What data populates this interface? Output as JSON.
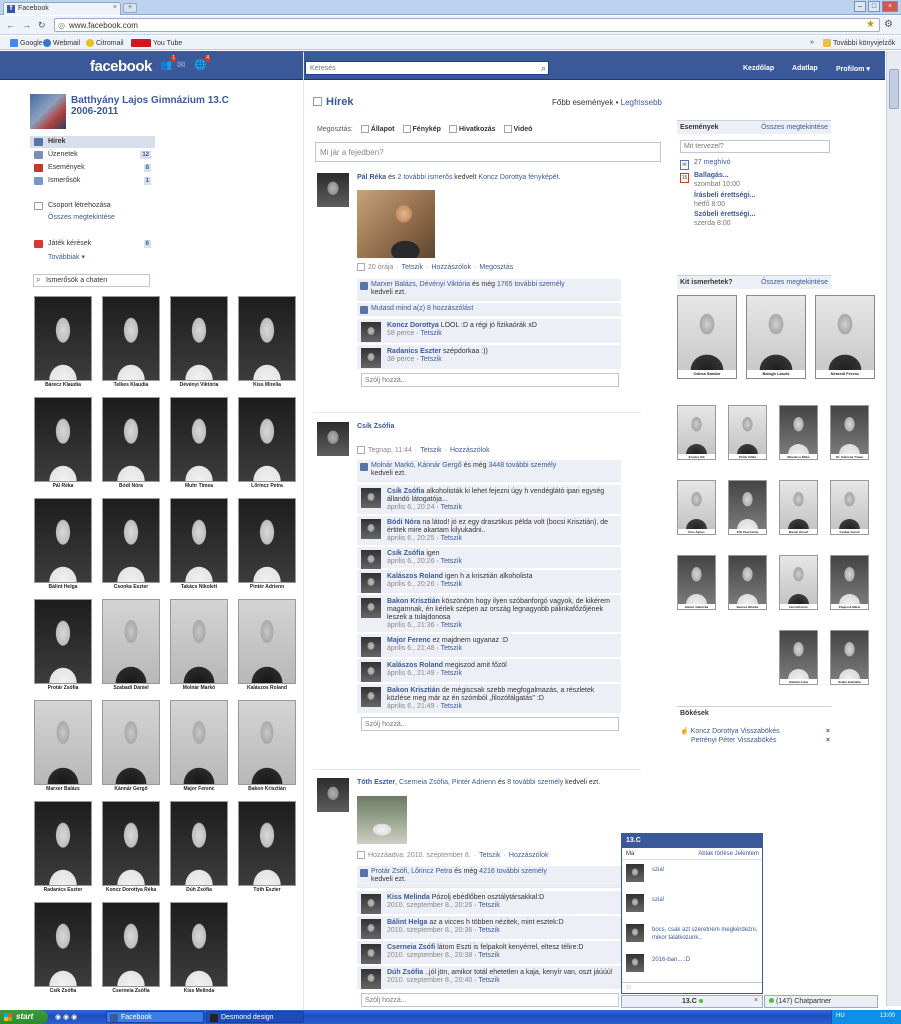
{
  "browser": {
    "tab_title": "Facebook",
    "url": "www.facebook.com",
    "bookmarks": [
      {
        "label": "Google",
        "color": "#4285f4"
      },
      {
        "label": "Webmail",
        "color": "#3a78c9"
      },
      {
        "label": "Citromail",
        "color": "#e5c21f"
      },
      {
        "label": "You Tube",
        "color": "#cc181e"
      }
    ],
    "other_bookmarks": "További könyvjelzők",
    "overflow": "»"
  },
  "header": {
    "logo": "facebook",
    "notif_counts": [
      "1",
      "4"
    ],
    "search_placeholder": "Keresés",
    "links": [
      "Kezdőlap",
      "Adatlap",
      "Profilom ▾"
    ]
  },
  "group": {
    "name": "Batthyány Lajos Gimnázium 13.C 2006-2011",
    "nav": [
      {
        "label": "Hírek",
        "count": "",
        "selected": true,
        "color": "#5b74a8"
      },
      {
        "label": "Üzenetek",
        "count": "12",
        "color": "#7a8fb8"
      },
      {
        "label": "Események",
        "count": "8",
        "color": "#c0392b"
      },
      {
        "label": "Ismerősök",
        "count": "1",
        "color": "#7b96c9"
      }
    ],
    "create_group": "Csoport létrehozása",
    "see_all": "Összes megtekintése",
    "game_requests": "Játék kérések",
    "game_count": "6",
    "more": "Továbbiak ▾",
    "chat_search": "Ismerősök a chaten",
    "classmates": [
      "Bárecz Klaudia",
      "Telkes Klaudia",
      "Dévényi Viktória",
      "Kiss Mirella",
      "Pál Réka",
      "Bódi Nóra",
      "Muhr Tímea",
      "Lőrincz Petra",
      "Bálint Helga",
      "Csonka Eszter",
      "Takács Nikolett",
      "Pintér Adrienn",
      "Protár Zsófia",
      "Szabadi Dániel",
      "Molnár Markó",
      "Kalászos Roland",
      "Marxer Balázs",
      "Kánnár Gergő",
      "Major Ferenc",
      "Bakon Krisztián",
      "Radanics Eszter",
      "Koncz Dorottya Réka",
      "Dúh Zsófia",
      "Tóth Eszter",
      "Csík Zsófia",
      "Cserneia Zsófia",
      "Kiss Melinda"
    ]
  },
  "feed": {
    "title": "Hírek",
    "top_stories": "Főbb események",
    "sep": " • ",
    "most_recent": "Legfrissebb",
    "share_label": "Megosztás:",
    "share_options": [
      "Állapot",
      "Fénykép",
      "Hivatkozás",
      "Videó"
    ],
    "status_placeholder": "Mi jár a fejedben?",
    "reply_placeholder": "Szólj hozzá...",
    "story1": {
      "author": "Pál Réka",
      "mid": " és ",
      "others": "2 további ismerős",
      "tail": " kedvelt ",
      "target": "Koncz Dorottya fényképét.",
      "meta_time": "20 órája",
      "meta_links": [
        "Tetszik",
        "Hozzászólok",
        "Megosztás"
      ],
      "likes_names": "Marxer Balázs, Dévényi Viktória",
      "likes_mid": " és még ",
      "likes_count": "1765 további személy",
      "likes_tail": "kedveli ezt.",
      "show_all": "Mutasd mind a(z) 8 hozzászólást",
      "comments": [
        {
          "name": "Koncz Dorottya",
          "text": "LOOL :D a régi jó fizikaórák xD",
          "time": "58 perce",
          "like": "Tetszik"
        },
        {
          "name": "Radanics Eszter",
          "text": "szépdorkaa :))",
          "time": "38 perce",
          "like": "Tetszik"
        }
      ]
    },
    "story2": {
      "author": "Csík Zsófia",
      "meta_time": "Tegnap, 11:44",
      "meta_links": [
        "Tetszik",
        "Hozzászólok"
      ],
      "likes_names": "Molnár Markó, Kánnár Gergő",
      "likes_mid": " és még ",
      "likes_count": "3448 további személy",
      "likes_tail": "kedveli ezt.",
      "comments": [
        {
          "name": "Csík Zsófia",
          "text": "alkoholisták ki lehet fejezni úgy h vendéglátó ipari egység állandó látogatója...",
          "time": "április 6., 20:24",
          "like": "Tetszik"
        },
        {
          "name": "Bódi Nóra",
          "text": "na látod! jó ez egy drasztikus példa volt (bocsi Krisztián), de értitek mire akartam kilyukadni..",
          "time": "április 6., 20:25",
          "like": "Tetszik"
        },
        {
          "name": "Csík Zsófia",
          "text": "igen",
          "time": "április 6., 20:26",
          "like": "Tetszik"
        },
        {
          "name": "Kalászos Roland",
          "text": "igen h a krisztián alkoholista",
          "time": "április 6., 20:26",
          "like": "Tetszik"
        },
        {
          "name": "Bakon Krisztián",
          "text": "köszönöm hogy ilyen szóbanforgó vagyok, de kikérem magamnak, én kérlek szépen az ország legnagyobb pálinkafőzőjének leszek a tulajdonosa",
          "time": "április 6., 21:36",
          "like": "Tetszik"
        },
        {
          "name": "Major Ferenc",
          "text": "ez majdnem ugyanaz :D",
          "time": "április 6., 21:48",
          "like": "Tetszik"
        },
        {
          "name": "Kalászos Roland",
          "text": "megiszod amit főzöl",
          "time": "április 6., 21:49",
          "like": "Tetszik"
        },
        {
          "name": "Bakon Krisztián",
          "text": "de mégiscsak szebb megfogalmazás, a részletek közlése meg már az én szómból „filozófálgatás\" :D",
          "time": "április 6., 21:49",
          "like": "Tetszik"
        }
      ]
    },
    "story3": {
      "author": "Tóth Eszter",
      "mid": ", ",
      "others": "Cserneia Zsófia, Pintér Adrienn",
      "and": " és ",
      "count": "8 további személy",
      "tail": " kedveli ezt.",
      "meta_time": "Hozzáadva: 2010. szeptember 8.",
      "meta_links": [
        "Tetszik",
        "Hozzászólok"
      ],
      "likes_names": "Protár Zsófi, Lőrincz Petra",
      "likes_mid": " és még ",
      "likes_count": "4216 további személy",
      "likes_tail": "kedveli ezt.",
      "comments": [
        {
          "name": "Kiss Melinda",
          "text": "Pózolj ebédlőben osztálytársakkal:D",
          "time": "2010. szeptember 8., 20:26",
          "like": "Tetszik"
        },
        {
          "name": "Bálint Helga",
          "text": "az a vicces h többen nézitek, mint esztek:D",
          "time": "2010. szeptember 8., 20:36",
          "like": "Tetszik"
        },
        {
          "name": "Cserneia Zsófi",
          "text": "látom Eszti is felpakolt kenyérrel, eltesz télire:D",
          "time": "2010. szeptember 8., 20:38",
          "like": "Tetszik"
        },
        {
          "name": "Dúh Zsófia",
          "text": "..jól jön, amikor totál ehetetlen a kaja, kenyír van, oszt jáúúú!",
          "time": "2010. szeptember 8., 20:40",
          "like": "Tetszik"
        }
      ]
    }
  },
  "right": {
    "events_title": "Események",
    "see_all": "Összes megtekintése",
    "event_placeholder": "Mit tervezel?",
    "invites": "27 meghívó",
    "events": [
      {
        "name": "Ballagás...",
        "time": "szombat 10:00"
      },
      {
        "name": "Írásbeli érettségi...",
        "time": "hétfő 8:00"
      },
      {
        "name": "Szóbeli érettségi...",
        "time": "szerda 8:00"
      }
    ],
    "know_title": "Kit ismerhetek?",
    "teachers_big": [
      "Odesa Sándor",
      "Balogh László",
      "Némedi Ferenc"
    ],
    "teachers_small": [
      "Kovács Ildi",
      "Pintér Ildikó",
      "Mészáros Ildikó",
      "Dr. Gáborné Tímea",
      "Kiss Ágnes",
      "Zöll Zsuzsanna",
      "Bienai József",
      "Csabai József",
      "Kántor Gabriella",
      "Bencze Mónika",
      "Horváth Imre",
      "Pappová Mária",
      "Kálmán Anna",
      "Szabó Gabriella"
    ],
    "pokes_title": "Bökések",
    "pokes": [
      {
        "name": "Koncz Dorottya",
        "action": "Visszabökés",
        "x": "×"
      },
      {
        "name": "Petrényi Péter",
        "action": "Visszabökés",
        "x": "×"
      }
    ]
  },
  "chat": {
    "title": "13.C",
    "today": "Ma",
    "clear": "Ablak törlése",
    "sep": " ",
    "report": "Jelentem",
    "messages": [
      "szia!",
      "szia!",
      "bocs, csak azt szeretném megkérdezni, mikor találkozunk..",
      "2016-ban....:D"
    ],
    "tab_label": "13.C",
    "close": "×",
    "partners": "(147) Chatpartner"
  },
  "taskbar": {
    "start": "start",
    "tasks": [
      "Facebook",
      "Desmond design"
    ],
    "lang": "HU",
    "clock": "13:00"
  }
}
